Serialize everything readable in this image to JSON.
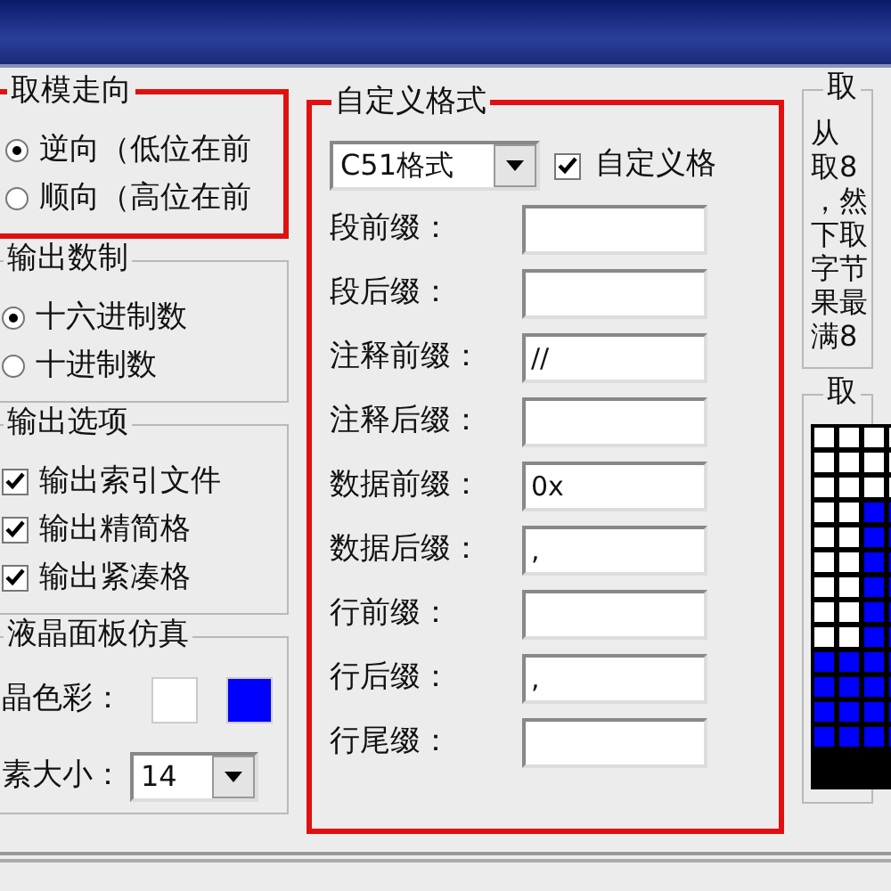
{
  "scan_direction": {
    "title": "取模走向",
    "highlighted": true,
    "options": [
      {
        "label": "逆向（低位在前",
        "selected": true
      },
      {
        "label": "顺向（高位在前",
        "selected": false
      }
    ]
  },
  "output_base": {
    "title": "输出数制",
    "highlighted": false,
    "options": [
      {
        "label": "十六进制数",
        "selected": true
      },
      {
        "label": "十进制数",
        "selected": false
      }
    ]
  },
  "output_options": {
    "title": "输出选项",
    "items": [
      {
        "label": "输出索引文件",
        "checked": true
      },
      {
        "label": "输出精简格",
        "checked": true
      },
      {
        "label": "输出紧凑格",
        "checked": true
      }
    ]
  },
  "lcd_sim": {
    "title": "液晶面板仿真",
    "color_label": "晶色彩：",
    "colors": [
      {
        "color": "#ffffff"
      },
      {
        "color": "#0000ff"
      }
    ],
    "size_label": "素大小：",
    "size": "14"
  },
  "custom_format": {
    "title": "自定义格式",
    "highlighted": true,
    "preset": "C51格式",
    "custom_checkbox": {
      "label": "自定义格",
      "checked": true
    },
    "fields": [
      {
        "label": "段前缀："
      },
      {
        "label": "段后缀："
      },
      {
        "label": "注释前缀：",
        "value": "//"
      },
      {
        "label": "注释后缀："
      },
      {
        "label": "数据前缀：",
        "value": "0x"
      },
      {
        "label": "数据后缀：",
        "value": ","
      },
      {
        "label": "行前缀："
      },
      {
        "label": "行后缀：",
        "value": ","
      },
      {
        "label": "行尾缀："
      }
    ]
  },
  "right_panel": {
    "title": "取",
    "lines": [
      "从",
      "取8",
      "，然",
      "下取",
      "字节",
      "果最",
      "满8"
    ],
    "preview_title": "取"
  }
}
